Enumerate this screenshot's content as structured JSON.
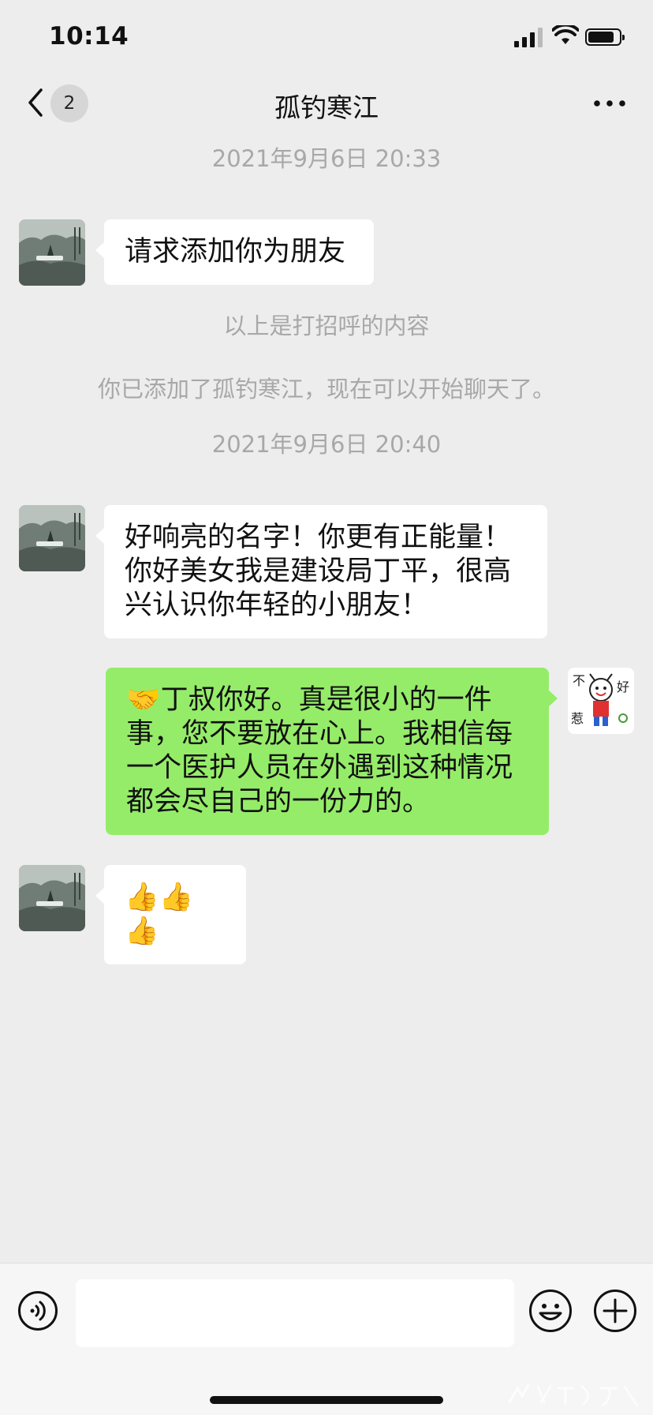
{
  "status_bar": {
    "time": "10:14"
  },
  "header": {
    "back_count": "2",
    "title": "孤钓寒江"
  },
  "chat": {
    "timestamps": [
      "2021年9月6日 20:33",
      "2021年9月6日 20:40"
    ],
    "system_notes": [
      "以上是打招呼的内容",
      "你已添加了孤钓寒江，现在可以开始聊天了。"
    ],
    "messages": [
      {
        "sender": "contact",
        "lines": [
          "请求添加你为朋友"
        ]
      },
      {
        "sender": "contact",
        "lines": [
          "好响亮的名字！你更有正能量！",
          "你好美女我是建设局丁平，很高",
          "兴认识你年轻的小朋友！"
        ]
      },
      {
        "sender": "me",
        "lines": [
          "🤝丁叔你好。真是很小的一件",
          "事，您不要放在心上。我相信每",
          "一个医护人员在外遇到这种情况",
          "都会尽自己的一份力的。"
        ]
      },
      {
        "sender": "contact",
        "lines": [
          "👍👍👍"
        ]
      }
    ],
    "my_avatar_text": [
      "不",
      "好",
      "惹"
    ]
  },
  "colors": {
    "background": "#ededed",
    "incoming_bubble": "#ffffff",
    "outgoing_bubble": "#95ec69",
    "muted_text": "#a8a8a8"
  },
  "icons": {
    "back": "chevron-left-icon",
    "more": "more-dots-icon",
    "voice": "voice-icon",
    "emoji": "emoji-icon",
    "plus": "plus-icon"
  }
}
